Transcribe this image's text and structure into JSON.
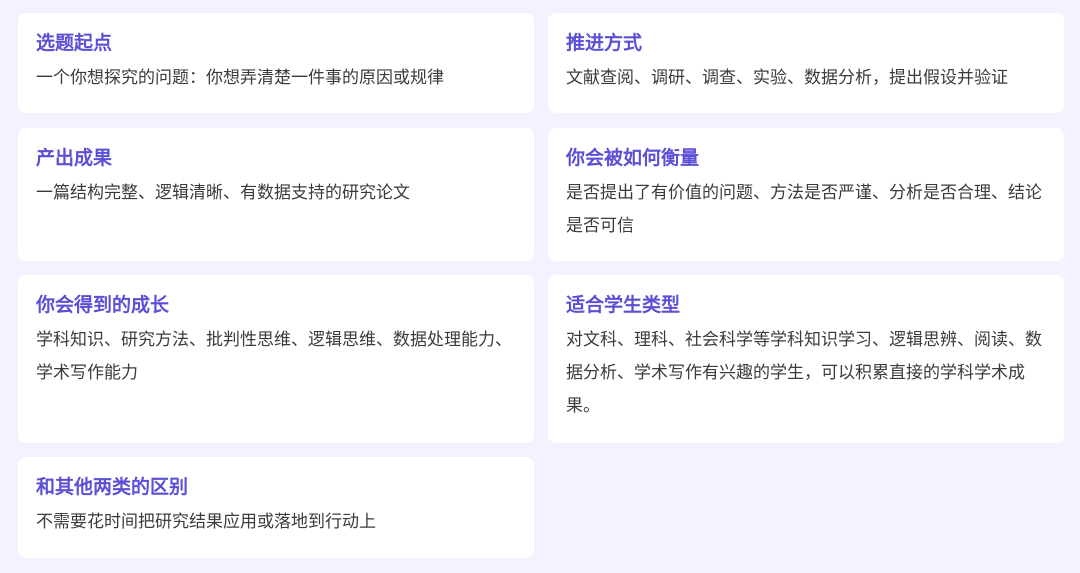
{
  "cards": [
    {
      "title": "选题起点",
      "text": "一个你想探究的问题：你想弄清楚一件事的原因或规律"
    },
    {
      "title": "推进方式",
      "text": "文献查阅、调研、调查、实验、数据分析，提出假设并验证"
    },
    {
      "title": "产出成果",
      "text": "一篇结构完整、逻辑清晰、有数据支持的研究论文"
    },
    {
      "title": "你会被如何衡量",
      "text": "是否提出了有价值的问题、方法是否严谨、分析是否合理、结论是否可信"
    },
    {
      "title": "你会得到的成长",
      "text": "学科知识、研究方法、批判性思维、逻辑思维、数据处理能力、学术写作能力"
    },
    {
      "title": "适合学生类型",
      "text": "对文科、理科、社会科学等学科知识学习、逻辑思辨、阅读、数据分析、学术写作有兴趣的学生，可以积累直接的学科学术成果。"
    },
    {
      "title": "和其他两类的区别",
      "text": "不需要花时间把研究结果应用或落地到行动上"
    }
  ]
}
